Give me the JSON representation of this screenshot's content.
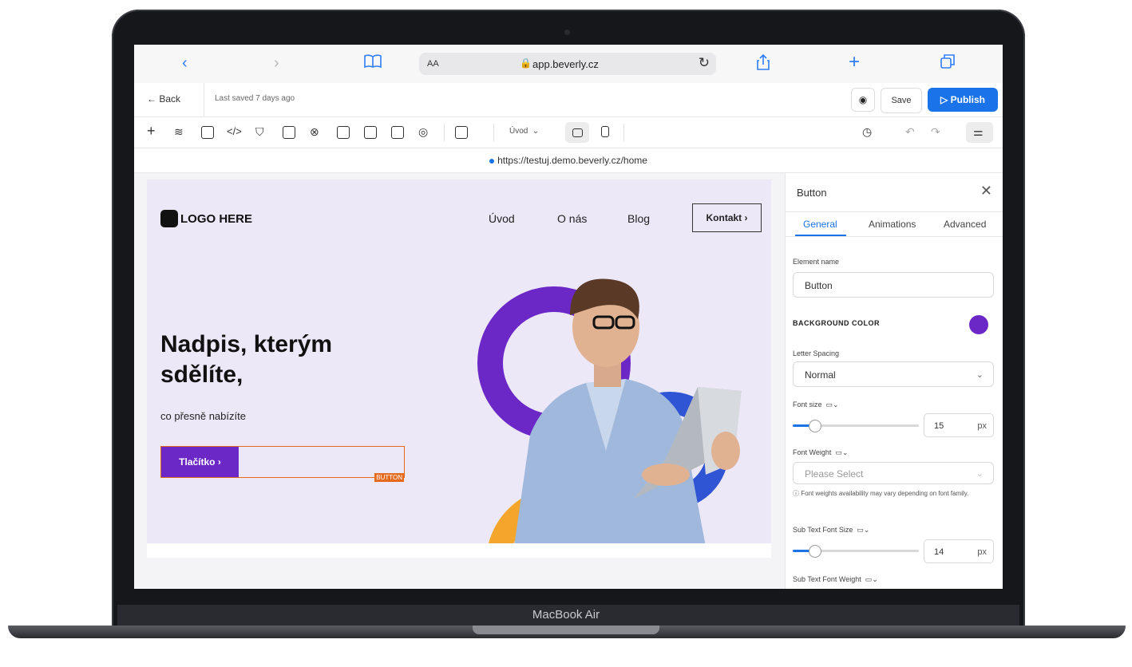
{
  "device": {
    "label": "MacBook Air"
  },
  "browser": {
    "text_size": "AA",
    "host": "app.beverly.cz"
  },
  "topbar": {
    "back_label": "← Back",
    "saved_text": "Last saved 7 days ago",
    "save_label": "Save",
    "publish_label": "Publish"
  },
  "toolbar": {
    "page_select": "Úvod"
  },
  "preview_url": "https://testuj.demo.beverly.cz/home",
  "hero": {
    "logo_text": "LOGO HERE",
    "nav": [
      "Úvod",
      "O nás",
      "Blog"
    ],
    "contact_label": "Kontakt ›",
    "heading": "Nadpis, kterým sdělíte,",
    "subtitle": "co přesně nabízíte",
    "cta_label": "Tlačítko ›",
    "selection_tag": "BUTTON"
  },
  "panel": {
    "title": "Button",
    "tabs": [
      "General",
      "Animations",
      "Advanced"
    ],
    "element_name_label": "Element name",
    "element_name_value": "Button",
    "bg_color_label": "BACKGROUND COLOR",
    "bg_color_value": "#6c27c7",
    "letter_spacing_label": "Letter Spacing",
    "letter_spacing_value": "Normal",
    "font_size_label": "Font size",
    "font_size_value": "15",
    "font_size_unit": "px",
    "font_weight_label": "Font Weight",
    "font_weight_placeholder": "Please Select",
    "font_weight_note": "Font weights availability may vary depending on font family.",
    "sub_font_size_label": "Sub Text Font Size",
    "sub_font_size_value": "14",
    "sub_font_size_unit": "px",
    "sub_font_weight_label": "Sub Text Font Weight"
  },
  "colors": {
    "accent": "#1a73e8",
    "brand_purple": "#6c27c7",
    "selection_orange": "#e56a1e"
  }
}
